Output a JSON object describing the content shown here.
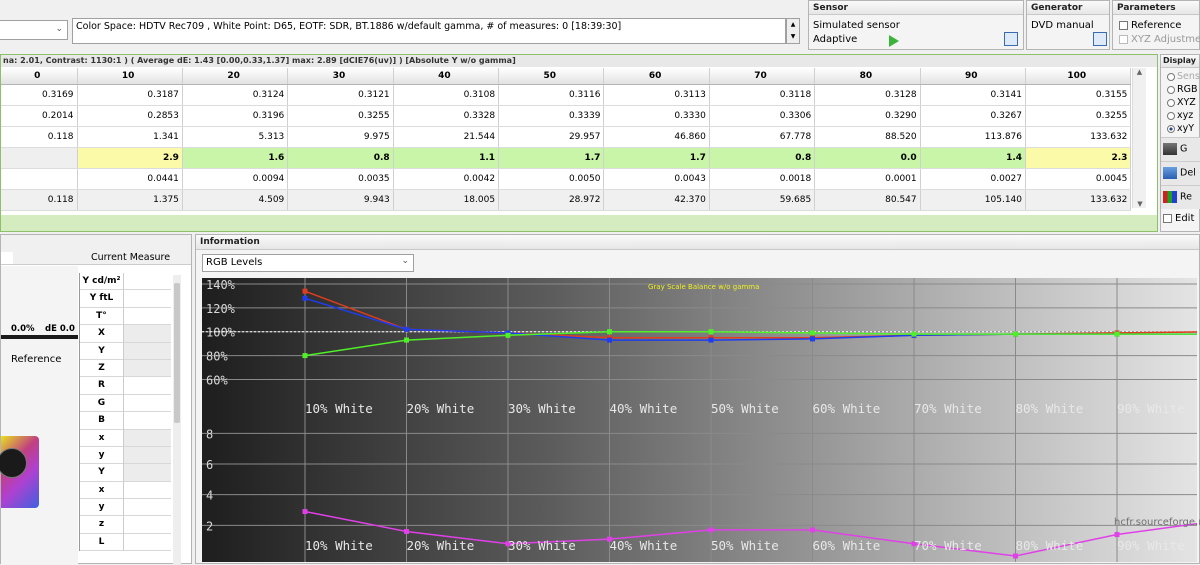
{
  "top": {
    "info_text": "Color Space: HDTV Rec709 , White Point: D65, EOTF:  SDR, BT.1886 w/default gamma, # of measures: 0 [18:39:30]"
  },
  "sensor": {
    "title": "Sensor",
    "name": "Simulated sensor",
    "mode": "Adaptive"
  },
  "generator": {
    "title": "Generator",
    "name": "DVD manual"
  },
  "parameters": {
    "title": "Parameters",
    "reference_label": "Reference",
    "xyz_label": "XYZ Adjustmen"
  },
  "summary": {
    "text": "na: 2.01, Contrast: 1130:1 ) ( Average dE: 1.43 [0.00,0.33,1.37] max: 2.89 [dCIE76(uv)] ) [Absolute Y w/o gamma]"
  },
  "table": {
    "columns": [
      "0",
      "10",
      "20",
      "30",
      "40",
      "50",
      "60",
      "70",
      "80",
      "90",
      "100"
    ],
    "rows": [
      {
        "kind": "w",
        "cells": [
          "0.3169",
          "0.3187",
          "0.3124",
          "0.3121",
          "0.3108",
          "0.3116",
          "0.3113",
          "0.3118",
          "0.3128",
          "0.3141",
          "0.3155"
        ]
      },
      {
        "kind": "w",
        "cells": [
          "0.2014",
          "0.2853",
          "0.3196",
          "0.3255",
          "0.3328",
          "0.3339",
          "0.3330",
          "0.3306",
          "0.3290",
          "0.3267",
          "0.3255"
        ]
      },
      {
        "kind": "w",
        "cells": [
          "0.118",
          "1.341",
          "5.313",
          "9.975",
          "21.544",
          "29.957",
          "46.860",
          "67.778",
          "88.520",
          "113.876",
          "133.632"
        ]
      },
      {
        "kind": "de",
        "cells": [
          "",
          "2.9",
          "1.6",
          "0.8",
          "1.1",
          "1.7",
          "1.7",
          "0.8",
          "0.0",
          "1.4",
          "2.3"
        ]
      },
      {
        "kind": "w",
        "cells": [
          "",
          "0.0441",
          "0.0094",
          "0.0035",
          "0.0042",
          "0.0050",
          "0.0043",
          "0.0018",
          "0.0001",
          "0.0027",
          "0.0045"
        ]
      },
      {
        "kind": "g",
        "cells": [
          "0.118",
          "1.375",
          "4.509",
          "9.943",
          "18.005",
          "28.972",
          "42.370",
          "59.685",
          "80.547",
          "105.140",
          "133.632"
        ]
      }
    ]
  },
  "display": {
    "title": "Display",
    "options": [
      {
        "label": "Sens",
        "selected": false,
        "disabled": true
      },
      {
        "label": "RGB",
        "selected": false,
        "disabled": false
      },
      {
        "label": "XYZ",
        "selected": false,
        "disabled": false
      },
      {
        "label": "xyz",
        "selected": false,
        "disabled": false
      },
      {
        "label": "xyY",
        "selected": true,
        "disabled": false
      }
    ],
    "buttons": [
      {
        "label": "G"
      },
      {
        "label": "Del"
      },
      {
        "label": "Re"
      }
    ],
    "edit_label": "Edit"
  },
  "left": {
    "pct": "0.0%",
    "de": "dE 0.0",
    "reference": "Reference",
    "current_measure": "Current Measure",
    "labels": [
      "Y cd/m²",
      "Y ftL",
      "T°",
      "X",
      "Y",
      "Z",
      "R",
      "G",
      "B",
      "x",
      "y",
      "Y",
      "x",
      "y",
      "z",
      "L"
    ]
  },
  "info": {
    "title": "Information",
    "dropdown": "RGB Levels",
    "chart_title": "Gray Scale Balance w/o gamma",
    "watermark": "hcfr.sourceforge.n"
  },
  "chart_data": {
    "type": "line",
    "title": "Gray Scale Balance w/o gamma",
    "top_plot": {
      "ytick_labels": [
        "140%",
        "120%",
        "100%",
        "80%",
        "60%"
      ],
      "ylim": [
        52,
        140
      ],
      "categories": [
        "10% White",
        "20% White",
        "30% White",
        "40% White",
        "50% White",
        "60% White",
        "70% White",
        "80% White",
        "90% White"
      ],
      "series": [
        {
          "color": "#e03c1e",
          "values": [
            134,
            102,
            99,
            95,
            95,
            95,
            97,
            98,
            99,
            100
          ]
        },
        {
          "color": "#1e3cf0",
          "values": [
            128,
            102,
            99,
            93,
            93,
            94,
            97,
            98,
            98,
            98
          ]
        },
        {
          "color": "#50f028",
          "values": [
            80,
            93,
            97,
            100,
            100,
            99,
            98,
            98,
            98,
            98
          ]
        }
      ],
      "reference_value": 100
    },
    "bottom_plot": {
      "ytick_labels": [
        "8",
        "6",
        "4",
        "2"
      ],
      "ylim": [
        0,
        9
      ],
      "categories": [
        "10% White",
        "20% White",
        "30% White",
        "40% White",
        "50% White",
        "60% White",
        "70% White",
        "80% White",
        "90% White"
      ],
      "series": [
        {
          "color": "#e040e8",
          "values": [
            2.9,
            1.6,
            0.8,
            1.1,
            1.7,
            1.7,
            0.8,
            0.0,
            1.4,
            2.3
          ]
        }
      ]
    }
  }
}
